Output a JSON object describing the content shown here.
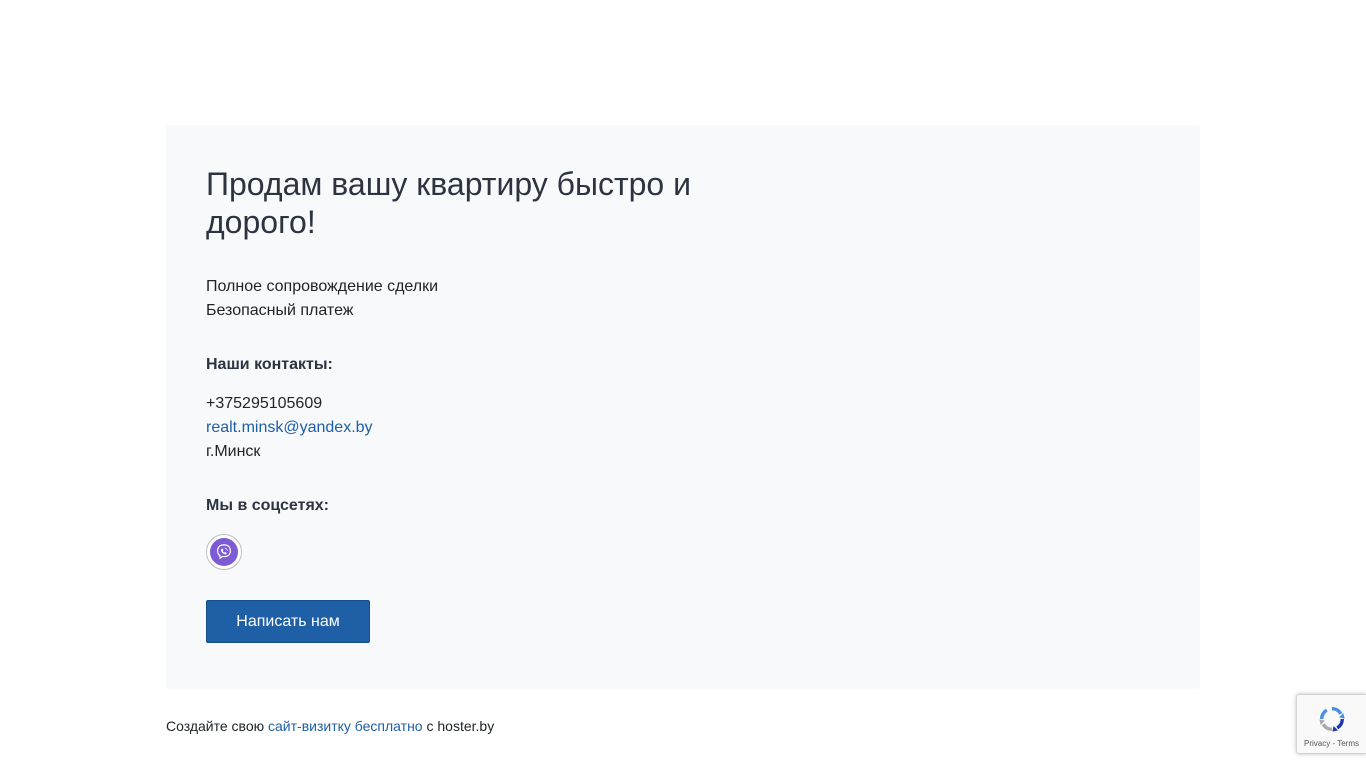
{
  "hero": {
    "headline": "Продам вашу квартиру быстро и дорого!",
    "features": [
      "Полное сопровождение сделки",
      "Безопасный платеж"
    ]
  },
  "contacts": {
    "title": "Наши контакты:",
    "phone": "+375295105609",
    "email": "realt.minsk@yandex.by",
    "city": "г.Минск"
  },
  "social": {
    "title": "Мы в соцсетях:",
    "networks": [
      {
        "icon": "viber-icon",
        "color": "#7d5bd4"
      }
    ]
  },
  "actions": {
    "write_label": "Написать нам"
  },
  "footer": {
    "prefix": "Создайте свою",
    "link_text": "сайт-визитку бесплатно",
    "suffix": "с hoster.by"
  },
  "recaptcha": {
    "links": "Privacy - Terms"
  },
  "colors": {
    "accent": "#1e5fa6",
    "card_bg": "#f7f9fb",
    "viber": "#7d5bd4"
  }
}
